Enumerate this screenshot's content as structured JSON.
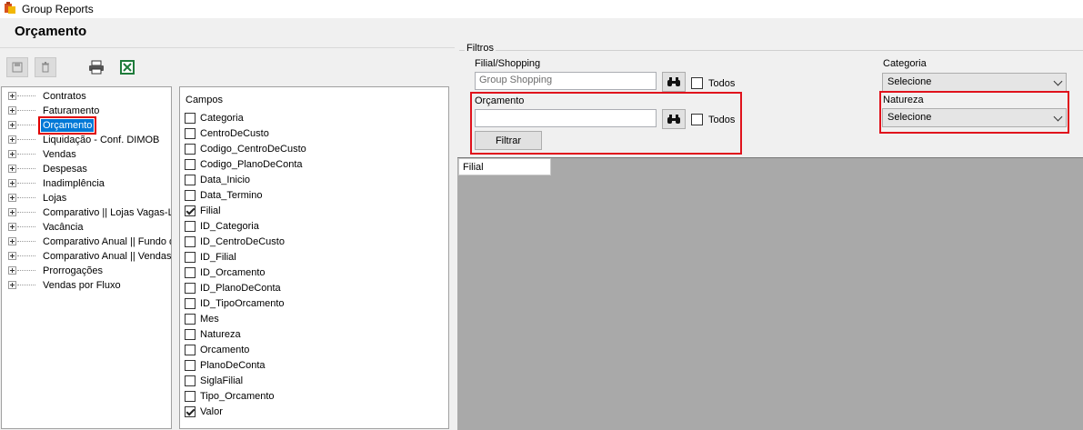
{
  "window": {
    "title": "Group Reports"
  },
  "page": {
    "title": "Orçamento"
  },
  "toolbar": {
    "icons": [
      "save-icon",
      "delete-icon",
      "print-icon",
      "excel-icon"
    ]
  },
  "tree": {
    "items": [
      {
        "label": "Contratos"
      },
      {
        "label": "Faturamento"
      },
      {
        "label": "Orçamento",
        "selected": true
      },
      {
        "label": "Liquidação - Conf. DIMOB"
      },
      {
        "label": "Vendas"
      },
      {
        "label": "Despesas"
      },
      {
        "label": "Inadimplência"
      },
      {
        "label": "Lojas"
      },
      {
        "label": "Comparativo || Lojas Vagas-L"
      },
      {
        "label": "Vacância"
      },
      {
        "label": "Comparativo Anual || Fundo d"
      },
      {
        "label": "Comparativo Anual || Vendas"
      },
      {
        "label": "Prorrogações"
      },
      {
        "label": "Vendas por Fluxo"
      }
    ]
  },
  "fields": {
    "title": "Campos",
    "items": [
      {
        "label": "Categoria",
        "checked": false
      },
      {
        "label": "CentroDeCusto",
        "checked": false
      },
      {
        "label": "Codigo_CentroDeCusto",
        "checked": false
      },
      {
        "label": "Codigo_PlanoDeConta",
        "checked": false
      },
      {
        "label": "Data_Inicio",
        "checked": false
      },
      {
        "label": "Data_Termino",
        "checked": false
      },
      {
        "label": "Filial",
        "checked": true
      },
      {
        "label": "ID_Categoria",
        "checked": false
      },
      {
        "label": "ID_CentroDeCusto",
        "checked": false
      },
      {
        "label": "ID_Filial",
        "checked": false
      },
      {
        "label": "ID_Orcamento",
        "checked": false
      },
      {
        "label": "ID_PlanoDeConta",
        "checked": false
      },
      {
        "label": "ID_TipoOrcamento",
        "checked": false
      },
      {
        "label": "Mes",
        "checked": false
      },
      {
        "label": "Natureza",
        "checked": false
      },
      {
        "label": "Orcamento",
        "checked": false
      },
      {
        "label": "PlanoDeConta",
        "checked": false
      },
      {
        "label": "SiglaFilial",
        "checked": false
      },
      {
        "label": "Tipo_Orcamento",
        "checked": false
      },
      {
        "label": "Valor",
        "checked": true
      }
    ]
  },
  "filters": {
    "title": "Filtros",
    "filial": {
      "label": "Filial/Shopping",
      "value": "Group Shopping",
      "todos_label": "Todos",
      "todos_checked": false
    },
    "orcamento": {
      "label": "Orçamento",
      "value": "",
      "todos_label": "Todos",
      "todos_checked": false
    },
    "filter_button": "Filtrar",
    "categoria": {
      "label": "Categoria",
      "value": "Selecione"
    },
    "natureza": {
      "label": "Natureza",
      "value": "Selecione"
    },
    "highlight_color": "#e0121c"
  },
  "grid": {
    "columns": [
      "Filial"
    ]
  },
  "colors": {
    "selection": "#0078d7",
    "grid_background": "#a9a9a9"
  }
}
